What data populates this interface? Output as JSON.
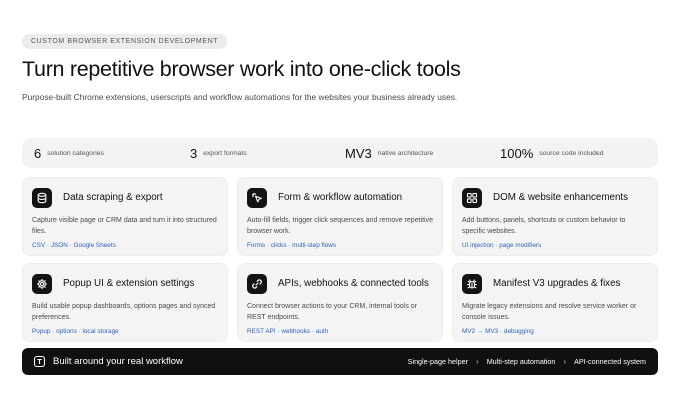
{
  "hero": {
    "eyebrow": "CUSTOM BROWSER EXTENSION DEVELOPMENT",
    "title": "Turn repetitive browser work into one-click tools",
    "subtitle": "Purpose-built Chrome extensions, userscripts and workflow automations for the websites your business already uses."
  },
  "stats": [
    {
      "value": "6",
      "label": "solution categories"
    },
    {
      "value": "3",
      "label": "export formats"
    },
    {
      "value": "MV3",
      "label": "native architecture"
    },
    {
      "value": "100%",
      "label": "source code included"
    }
  ],
  "cards": [
    {
      "icon": "database-icon",
      "title": "Data scraping & export",
      "desc": "Capture visible page or CRM data and turn it into structured files.",
      "tags": "CSV · JSON · Google Sheets"
    },
    {
      "icon": "pointer-click-icon",
      "title": "Form & workflow automation",
      "desc": "Auto-fill fields, trigger click sequences and remove repetitive browser work.",
      "tags": "Forms · clicks · multi-step flows"
    },
    {
      "icon": "grid-icon",
      "title": "DOM & website enhancements",
      "desc": "Add buttons, panels, shortcuts or custom behavior to specific websites.",
      "tags": "UI injection · page modifiers"
    },
    {
      "icon": "gear-icon",
      "title": "Popup UI & extension settings",
      "desc": "Build usable popup dashboards, options pages and synced preferences.",
      "tags": "Popup · options · local storage"
    },
    {
      "icon": "link-icon",
      "title": "APIs, webhooks & connected tools",
      "desc": "Connect browser actions to your CRM, internal tools or REST endpoints.",
      "tags": "REST API · webhooks · auth"
    },
    {
      "icon": "bug-icon",
      "title": "Manifest V3 upgrades & fixes",
      "desc": "Migrate legacy extensions and resolve service worker or console issues.",
      "tags": "MV2 → MV3 · debugging"
    }
  ],
  "bottom": {
    "icon": "tool-icon",
    "title": "Built around your real workflow",
    "steps": [
      "Single-page helper",
      "Multi-step automation",
      "API-connected system"
    ]
  }
}
